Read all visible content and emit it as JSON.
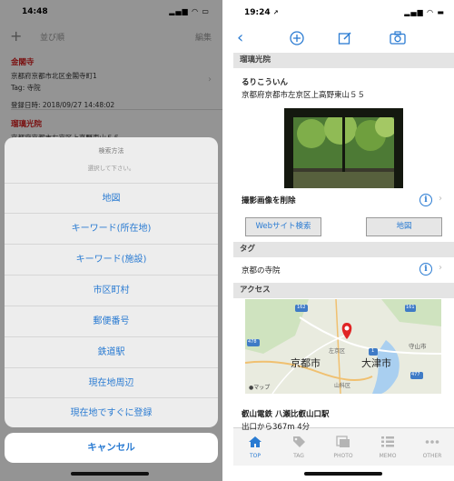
{
  "left": {
    "status": {
      "time": "14:48"
    },
    "navbar": {
      "add": "+",
      "title": "並び順",
      "edit": "編集"
    },
    "entries": [
      {
        "name": "金閣寺",
        "address": "京都府京都市北区金閣寺町1",
        "tag": "Tag: 寺院",
        "registered": "登録日時: 2018/09/27 14:48:02"
      },
      {
        "name": "瑠璃光院",
        "address": "京都府京都市左京区上高野東山５５"
      }
    ],
    "sheet": {
      "title": "検索方法",
      "message": "選択して下さい。",
      "options": [
        "地図",
        "キーワード(所在地)",
        "キーワード(施設)",
        "市区町村",
        "郵便番号",
        "鉄道駅",
        "現在地周辺",
        "現在地ですぐに登録"
      ],
      "cancel": "キャンセル"
    }
  },
  "right": {
    "status": {
      "time": "19:24",
      "loc": "↗"
    },
    "sections": {
      "place": "瑠璃光院",
      "tag": "タグ",
      "access": "アクセス"
    },
    "place": {
      "reading": "るりこういん",
      "address": "京都府京都市左京区上高野東山５５"
    },
    "photo_delete": "撮影画像を削除",
    "buttons": {
      "website": "Webサイト検索",
      "map": "地図"
    },
    "tag_value": "京都の寺院",
    "map": {
      "city1": "京都市",
      "city2": "大津市",
      "ward": "左京区",
      "ward2": "山科区",
      "city3": "守山市",
      "road1": "162",
      "road2": "478",
      "road3": "1",
      "road4": "161",
      "road5": "477",
      "credit": "マップ"
    },
    "access": {
      "station": "叡山電鉄 八瀬比叡山口駅",
      "walk": "出口から367m 4分"
    },
    "tabs": [
      "TOP",
      "TAG",
      "PHOTO",
      "MEMO",
      "OTHER"
    ],
    "accent": "#2a7bd2"
  }
}
